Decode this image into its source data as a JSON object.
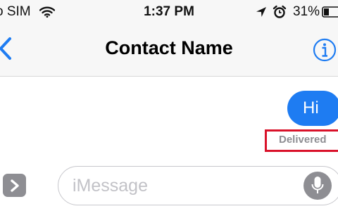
{
  "status_bar": {
    "carrier": "o SIM",
    "time": "1:37 PM",
    "battery_percent": "31%"
  },
  "nav": {
    "title": "Contact Name"
  },
  "conversation": {
    "messages": [
      {
        "text": "Hi",
        "direction": "outgoing"
      }
    ],
    "status": "Delivered"
  },
  "composer": {
    "placeholder": "iMessage"
  },
  "colors": {
    "accent": "#1e7cf2",
    "bubble_outgoing": "#1e7cf2",
    "highlight_box": "#d9122a",
    "muted_text": "#8e8e93"
  },
  "icons": {
    "wifi": "wifi-icon",
    "location": "location-arrow-icon",
    "alarm": "alarm-clock-icon",
    "battery": "battery-icon",
    "back": "chevron-left-icon",
    "info": "info-icon",
    "apps": "chevron-right-icon",
    "mic": "microphone-icon"
  }
}
